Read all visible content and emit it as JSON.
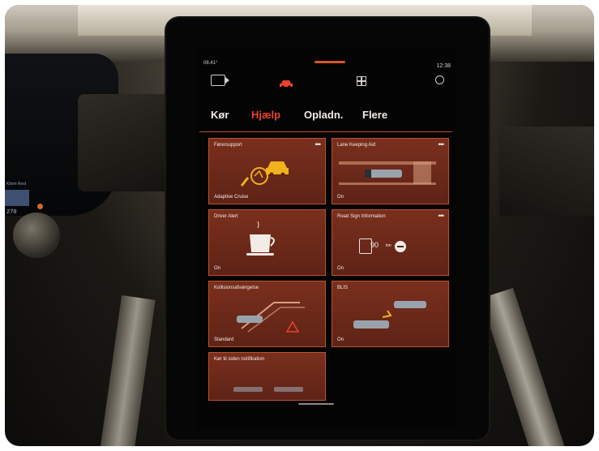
{
  "status": {
    "left": "08.41°",
    "time": "12:38"
  },
  "top_icons": [
    "camera-icon",
    "car-icon",
    "grid-icon",
    "power-icon"
  ],
  "tabs": [
    {
      "label": "Kør",
      "active": false
    },
    {
      "label": "Hjælp",
      "active": true
    },
    {
      "label": "Opladn.",
      "active": false
    },
    {
      "label": "Flere",
      "active": false
    }
  ],
  "cards": [
    {
      "title": "Førersupport",
      "status": "Adaptive Cruise",
      "dots": "•••",
      "icon": "adaptive-cruise-icon"
    },
    {
      "title": "Lane Keeping Aid",
      "status": "On",
      "dots": "•••",
      "icon": "lane-keeping-icon"
    },
    {
      "title": "Driver Alert",
      "status": "On",
      "dots": "",
      "icon": "coffee-cup-icon"
    },
    {
      "title": "Road Sign Information",
      "status": "On",
      "dots": "•••",
      "icon": "road-sign-icon"
    },
    {
      "title": "Kollisionsafværgelse",
      "status": "Standard",
      "dots": "",
      "icon": "collision-avoidance-icon"
    },
    {
      "title": "BLIS",
      "status": "On",
      "dots": "",
      "icon": "blis-icon"
    },
    {
      "title": "Kør til siden notifikation",
      "status": "",
      "dots": "",
      "icon": "pull-over-icon"
    }
  ],
  "road_sign": {
    "speed": "90",
    "unit": "km"
  },
  "cluster": {
    "label": "Kilom  Rest",
    "value": "270"
  },
  "colors": {
    "accent": "#e9422e",
    "card_bg": "#6b2819",
    "card_border": "#b9522f",
    "highlight": "#f0b31c"
  }
}
